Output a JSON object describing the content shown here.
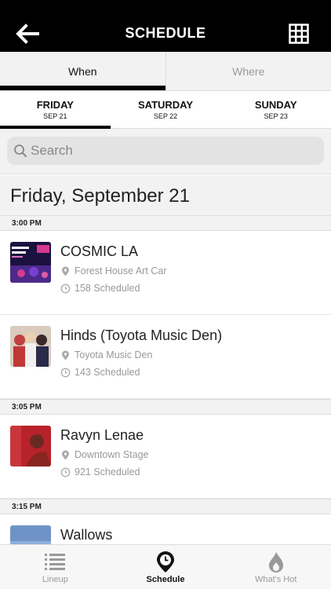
{
  "header": {
    "title": "SCHEDULE"
  },
  "view_tabs": [
    {
      "label": "When",
      "active": true
    },
    {
      "label": "Where",
      "active": false
    }
  ],
  "day_tabs": [
    {
      "name": "FRIDAY",
      "date": "SEP 21",
      "active": true
    },
    {
      "name": "SATURDAY",
      "date": "SEP 22",
      "active": false
    },
    {
      "name": "SUNDAY",
      "date": "SEP 23",
      "active": false
    }
  ],
  "search": {
    "placeholder": "Search",
    "value": ""
  },
  "day_heading": "Friday, September 21",
  "time_slots": [
    {
      "time": "3:00 PM"
    },
    {
      "time": "3:05 PM"
    },
    {
      "time": "3:15 PM"
    }
  ],
  "events": [
    {
      "title": "COSMIC LA",
      "location": "Forest House Art Car",
      "scheduled": "158 Scheduled",
      "thumb_color": "#2a1a5e"
    },
    {
      "title": "Hinds (Toyota Music Den)",
      "location": "Toyota Music Den",
      "scheduled": "143 Scheduled",
      "thumb_color": "#c9b8a8"
    },
    {
      "title": "Ravyn Lenae",
      "location": "Downtown Stage",
      "scheduled": "921 Scheduled",
      "thumb_color": "#b8222a"
    },
    {
      "title": "Wallows",
      "location": "",
      "scheduled": "",
      "thumb_color": "#6f93c6"
    }
  ],
  "bottom_nav": [
    {
      "label": "Lineup",
      "icon": "list-icon",
      "active": false
    },
    {
      "label": "Schedule",
      "icon": "clock-pin-icon",
      "active": true
    },
    {
      "label": "What's Hot",
      "icon": "flame-icon",
      "active": false
    }
  ],
  "colors": {
    "header_bg": "#000000",
    "active_indicator": "#000000",
    "muted_text": "#999999",
    "section_bg": "#f2f2f2"
  }
}
